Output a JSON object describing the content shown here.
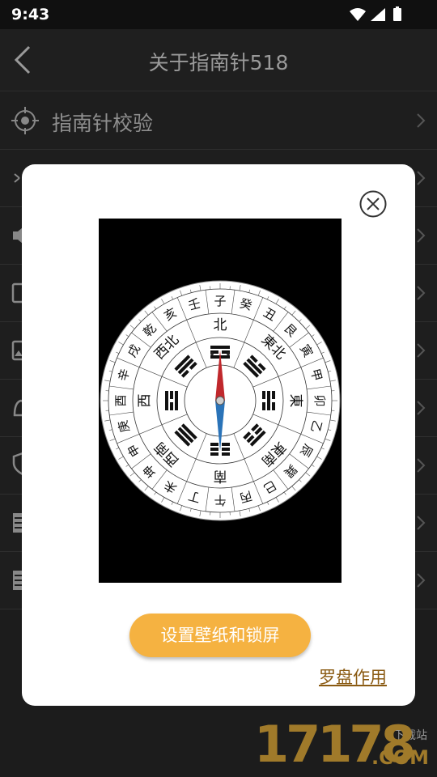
{
  "status": {
    "time": "9:43"
  },
  "header": {
    "title": "关于指南针518"
  },
  "menu": {
    "items": [
      {
        "label": "指南针校验",
        "icon": "target-icon"
      },
      {
        "label": "",
        "icon": "share-icon"
      },
      {
        "label": "",
        "icon": "speaker-icon"
      },
      {
        "label": "",
        "icon": "tablet-icon"
      },
      {
        "label": "",
        "icon": "image-icon"
      },
      {
        "label": "",
        "icon": "bell-icon"
      },
      {
        "label": "",
        "icon": "shield-icon"
      },
      {
        "label": "",
        "icon": "document-icon"
      },
      {
        "label": "",
        "icon": "document-icon"
      }
    ]
  },
  "dialog": {
    "set_button": "设置壁纸和锁屏",
    "link": "罗盘作用"
  },
  "compass": {
    "inner_labels": [
      "北",
      "東北",
      "東",
      "東南",
      "南",
      "西南",
      "西",
      "西北"
    ],
    "outer_labels": [
      "子",
      "癸",
      "丑",
      "艮",
      "寅",
      "甲",
      "卯",
      "乙",
      "辰",
      "巽",
      "巳",
      "丙",
      "午",
      "丁",
      "未",
      "坤",
      "申",
      "庚",
      "酉",
      "辛",
      "戌",
      "乾",
      "亥",
      "壬"
    ]
  },
  "watermark": {
    "number": "17178",
    "site": "下载站",
    "suffix": ".COM"
  },
  "colors": {
    "accent": "#f5b241",
    "link": "#8a5a12"
  }
}
